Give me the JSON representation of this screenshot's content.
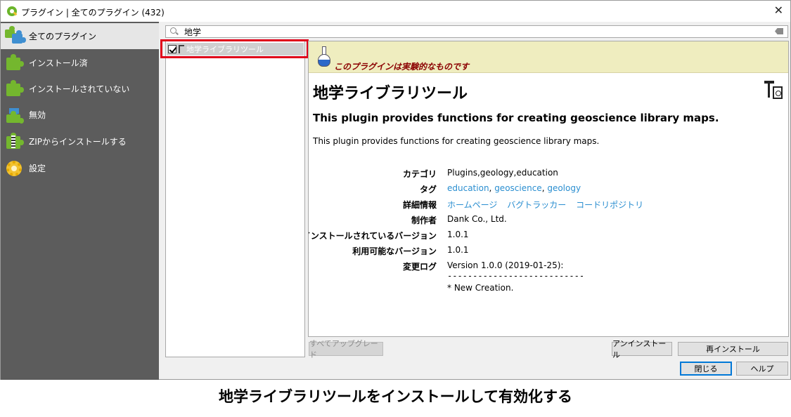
{
  "window": {
    "title": "プラグイン | 全てのプラグイン (432)",
    "close_glyph": "✕"
  },
  "sidebar": {
    "items": [
      {
        "label": "全てのプラグイン",
        "icon": "all-plugins-icon",
        "active": true
      },
      {
        "label": "インストール済",
        "icon": "installed-plugin-icon"
      },
      {
        "label": "インストールされていない",
        "icon": "not-installed-plugin-icon"
      },
      {
        "label": "無効",
        "icon": "invalid-plugin-icon"
      },
      {
        "label": "ZIPからインストールする",
        "icon": "zip-install-icon"
      },
      {
        "label": "設定",
        "icon": "settings-gear-icon"
      }
    ]
  },
  "search": {
    "value": "地学"
  },
  "plugin_list": {
    "items": [
      {
        "label": "地学ライブラリツール",
        "checked": true
      }
    ]
  },
  "details": {
    "experimental_warning": "このプラグインは実験的なものです",
    "title": "地学ライブラリツール",
    "summary": "This plugin provides functions for creating geoscience library maps.",
    "description": "This plugin provides functions for creating geoscience library maps.",
    "meta": {
      "category_label": "カテゴリ",
      "category_value": "Plugins,geology,education",
      "tags_label": "タグ",
      "tags": [
        "education",
        "geoscience",
        "geology"
      ],
      "tag_separator": ", ",
      "more_info_label": "詳細情報",
      "links": [
        "ホームページ",
        "バグトラッカー",
        "コードリポジトリ"
      ],
      "author_label": "制作者",
      "author": "Dank Co., Ltd.",
      "installed_version_label": "インストールされているバージョン",
      "installed_version": "1.0.1",
      "available_version_label": "利用可能なバージョン",
      "available_version": "1.0.1",
      "changelog_label": "変更ログ",
      "changelog_line1": "Version 1.0.0 (2019-01-25):",
      "changelog_line2": "---------------------------",
      "changelog_line3": "* New Creation."
    }
  },
  "buttons": {
    "upgrade_all": "すべてアップグレード",
    "uninstall": "アンインストール",
    "reinstall": "再インストール",
    "close": "閉じる",
    "help": "ヘルプ"
  },
  "caption": "地学ライブラリツールをインストールして有効化する",
  "colors": {
    "sidebar_bg": "#5c5c5c",
    "banner_bg": "#efedbf",
    "warning_text": "#8b0000",
    "link": "#2a8ed0",
    "highlight_border": "#e0001a"
  }
}
